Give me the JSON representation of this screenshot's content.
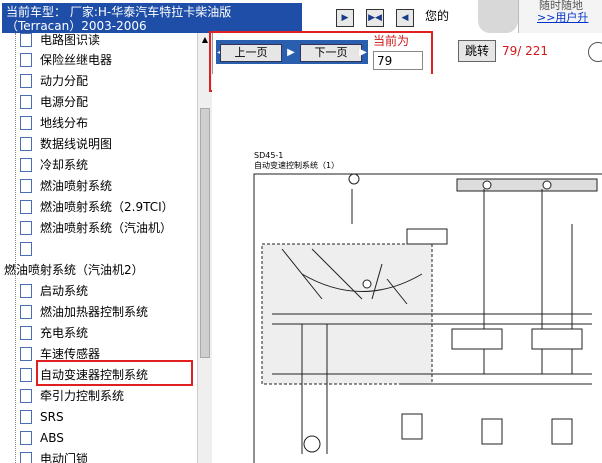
{
  "header": {
    "vehicle_title": "当前车型：  厂家:H-华泰汽车特拉卡柴油版（Terracan）2003-2006",
    "hint_text": "您的",
    "user_panel_line1": "随时随地",
    "user_panel_link": ">>用户升"
  },
  "sidebar": {
    "items_top": [
      "电路图识读",
      "保险丝继电器",
      "动力分配",
      "电源分配",
      "地线分布",
      "数据线说明图",
      "冷却系统",
      "燃油喷射系统",
      "燃油喷射系统（2.9TCI）",
      "燃油喷射系统（汽油机）",
      ""
    ],
    "folder_label": "燃油喷射系统（汽油机2）",
    "items_bottom": [
      "启动系统",
      "燃油加热器控制系统",
      "充电系统",
      "车速传感器",
      "自动变速器控制系统",
      "牵引力控制系统",
      "SRS",
      "ABS",
      "电动门锁"
    ]
  },
  "navigation": {
    "prev_label": "上一页",
    "next_label": "下一页",
    "current_label": "当前为",
    "page_value": "79",
    "jump_label": "跳转",
    "page_count": "79/ 221"
  },
  "diagram": {
    "code": "SD45-1",
    "title": "自动变速控制系统（1）"
  },
  "colors": {
    "highlight": "#e02020",
    "accent_blue": "#2a5fb0",
    "red_text": "#d01818"
  }
}
